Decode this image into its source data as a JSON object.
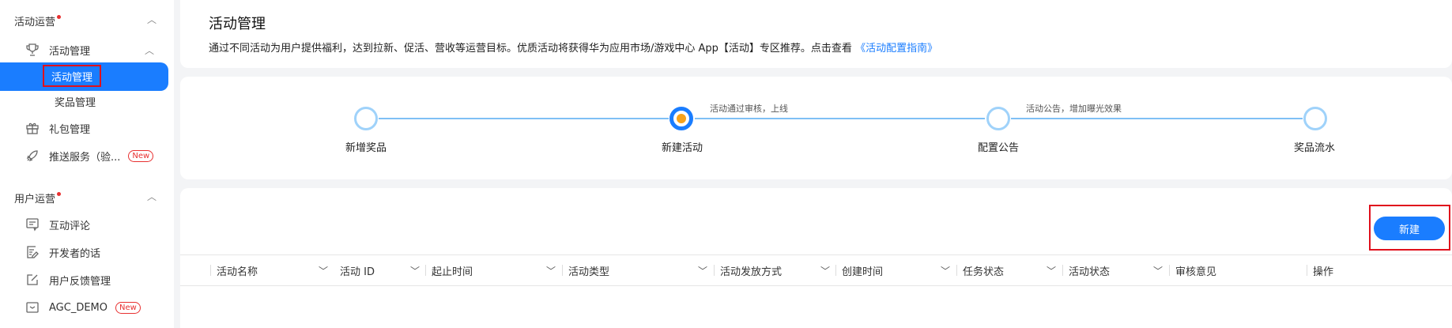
{
  "sidebar": {
    "section1": {
      "label": "活动运营"
    },
    "activity_group": {
      "label": "活动管理"
    },
    "activity_sub": {
      "label": "活动管理"
    },
    "prize_sub": {
      "label": "奖品管理"
    },
    "gift": {
      "label": "礼包管理"
    },
    "push": {
      "label": "推送服务（验...",
      "badge": "New"
    },
    "section2": {
      "label": "用户运营"
    },
    "comment": {
      "label": "互动评论"
    },
    "developer": {
      "label": "开发者的话"
    },
    "feedback": {
      "label": "用户反馈管理"
    },
    "agc": {
      "label": "AGC_DEMO",
      "badge": "New"
    }
  },
  "header": {
    "title": "活动管理",
    "desc": "通过不同活动为用户提供福利，达到拉新、促活、营收等运营目标。优质活动将获得华为应用市场/游戏中心 App【活动】专区推荐。点击查看",
    "link": "《活动配置指南》"
  },
  "steps": {
    "items": [
      {
        "label": "新增奖品"
      },
      {
        "label": "新建活动"
      },
      {
        "label": "配置公告"
      },
      {
        "label": "奖品流水"
      }
    ],
    "hint1": "活动通过审核，上线",
    "hint2": "活动公告，增加曝光效果"
  },
  "table": {
    "new_button": "新建",
    "columns": [
      "活动名称",
      "活动 ID",
      "起止时间",
      "活动类型",
      "活动发放方式",
      "创建时间",
      "任务状态",
      "活动状态",
      "审核意见",
      "操作"
    ]
  },
  "colors": {
    "accent": "#1a7dff",
    "highlight": "#e0101c",
    "step_active_center": "#f7a21b"
  }
}
